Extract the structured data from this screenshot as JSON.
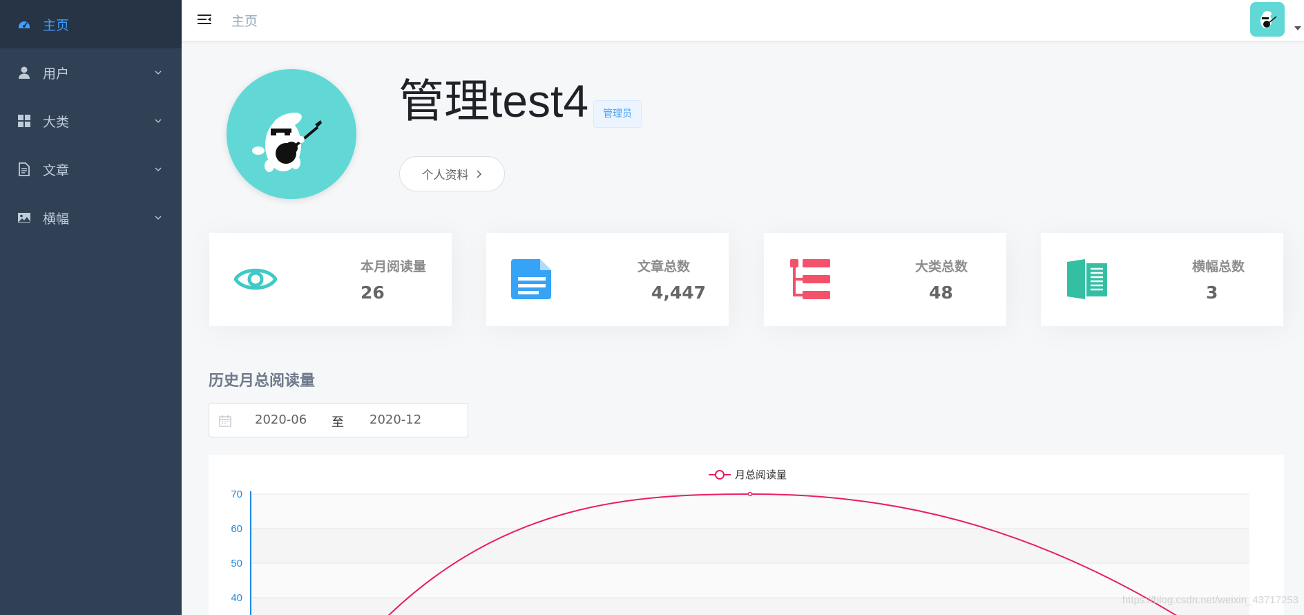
{
  "sidebar": {
    "items": [
      {
        "label": "主页",
        "icon": "dashboard-icon",
        "active": true
      },
      {
        "label": "用户",
        "icon": "user-icon"
      },
      {
        "label": "大类",
        "icon": "grid-icon"
      },
      {
        "label": "文章",
        "icon": "document-icon"
      },
      {
        "label": "横幅",
        "icon": "image-icon"
      }
    ]
  },
  "header": {
    "breadcrumb": "主页"
  },
  "profile": {
    "name": "管理test4",
    "role": "管理员",
    "button_label": "个人资料"
  },
  "stats": [
    {
      "label": "本月阅读量",
      "value": "26",
      "icon": "eye-icon",
      "color": "#40c9c6"
    },
    {
      "label": "文章总数",
      "value": "4,447",
      "icon": "document-icon",
      "color": "#36a3f7"
    },
    {
      "label": "大类总数",
      "value": "48",
      "icon": "tree-icon",
      "color": "#f4516c"
    },
    {
      "label": "横幅总数",
      "value": "3",
      "icon": "book-icon",
      "color": "#34bfa3"
    }
  ],
  "history": {
    "title": "历史月总阅读量",
    "start": "2020-06",
    "separator": "至",
    "end": "2020-12"
  },
  "chart_data": {
    "type": "line",
    "legend": "月总阅读量",
    "series": [
      {
        "name": "月总阅读量",
        "color": "#e91e63"
      }
    ],
    "y_ticks": [
      70,
      60,
      50,
      40
    ],
    "smooth": true,
    "peak_value": 70
  },
  "watermark": "https://blog.csdn.net/weixin_43717253"
}
